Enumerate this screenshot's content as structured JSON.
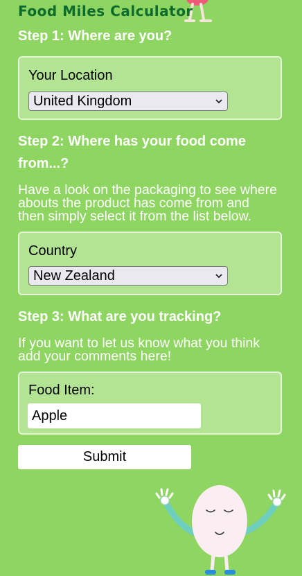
{
  "app": {
    "title": "Food Miles Calculator"
  },
  "step1": {
    "heading": "Step 1: Where are you?",
    "location_label": "Your Location",
    "location_value": "United Kingdom"
  },
  "step2": {
    "heading_line1": "Step 2: Where has your food come",
    "heading_line2": "from...?",
    "help_line1": "Have a look on the packaging to see where",
    "help_line2": "abouts the product has come from and",
    "help_line3": "then simply select it from the list below.",
    "country_label": "Country",
    "country_value": "New Zealand"
  },
  "step3": {
    "heading": "Step 3: What are you tracking?",
    "help_line1": "If you want to let us know what you think",
    "help_line2": "add your comments here!",
    "food_label": "Food Item:",
    "food_value": "Apple"
  },
  "form": {
    "submit_label": "Submit"
  },
  "colors": {
    "background": "#8ed562",
    "panel": "#b3e493",
    "title": "#0d6b2d",
    "mascot_body": "#fbeef3",
    "mascot_arms": "#6fcfbf",
    "mascot_feet": "#2a8fd8"
  },
  "icons": {
    "dropdown": "chevron-down-icon",
    "mascot": "egg-mascot"
  }
}
